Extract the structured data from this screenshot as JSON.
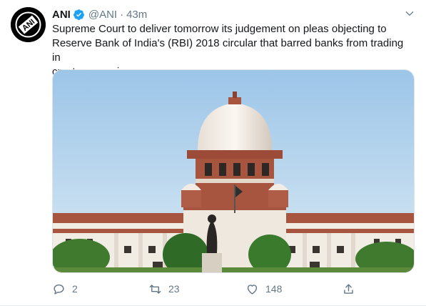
{
  "tweet": {
    "author_name": "ANI",
    "author_handle": "@ANI",
    "separator": "·",
    "time": "43m",
    "avatar_logo_text": "ANI",
    "text": "Supreme Court to deliver tomorrow its judgement on pleas objecting to\nReserve Bank of India's (RBI) 2018 circular that barred banks from trading in\ncryptocurrencies."
  },
  "actions": {
    "reply_count": "2",
    "retweet_count": "23",
    "like_count": "148"
  },
  "colors": {
    "verified_blue": "#1da1f2",
    "muted_text": "#657786",
    "sky": "#b8d6ee",
    "sandstone": "#a8553f"
  },
  "icons": [
    "verified-badge-icon",
    "chevron-down-icon",
    "reply-icon",
    "retweet-icon",
    "like-icon",
    "share-icon"
  ]
}
